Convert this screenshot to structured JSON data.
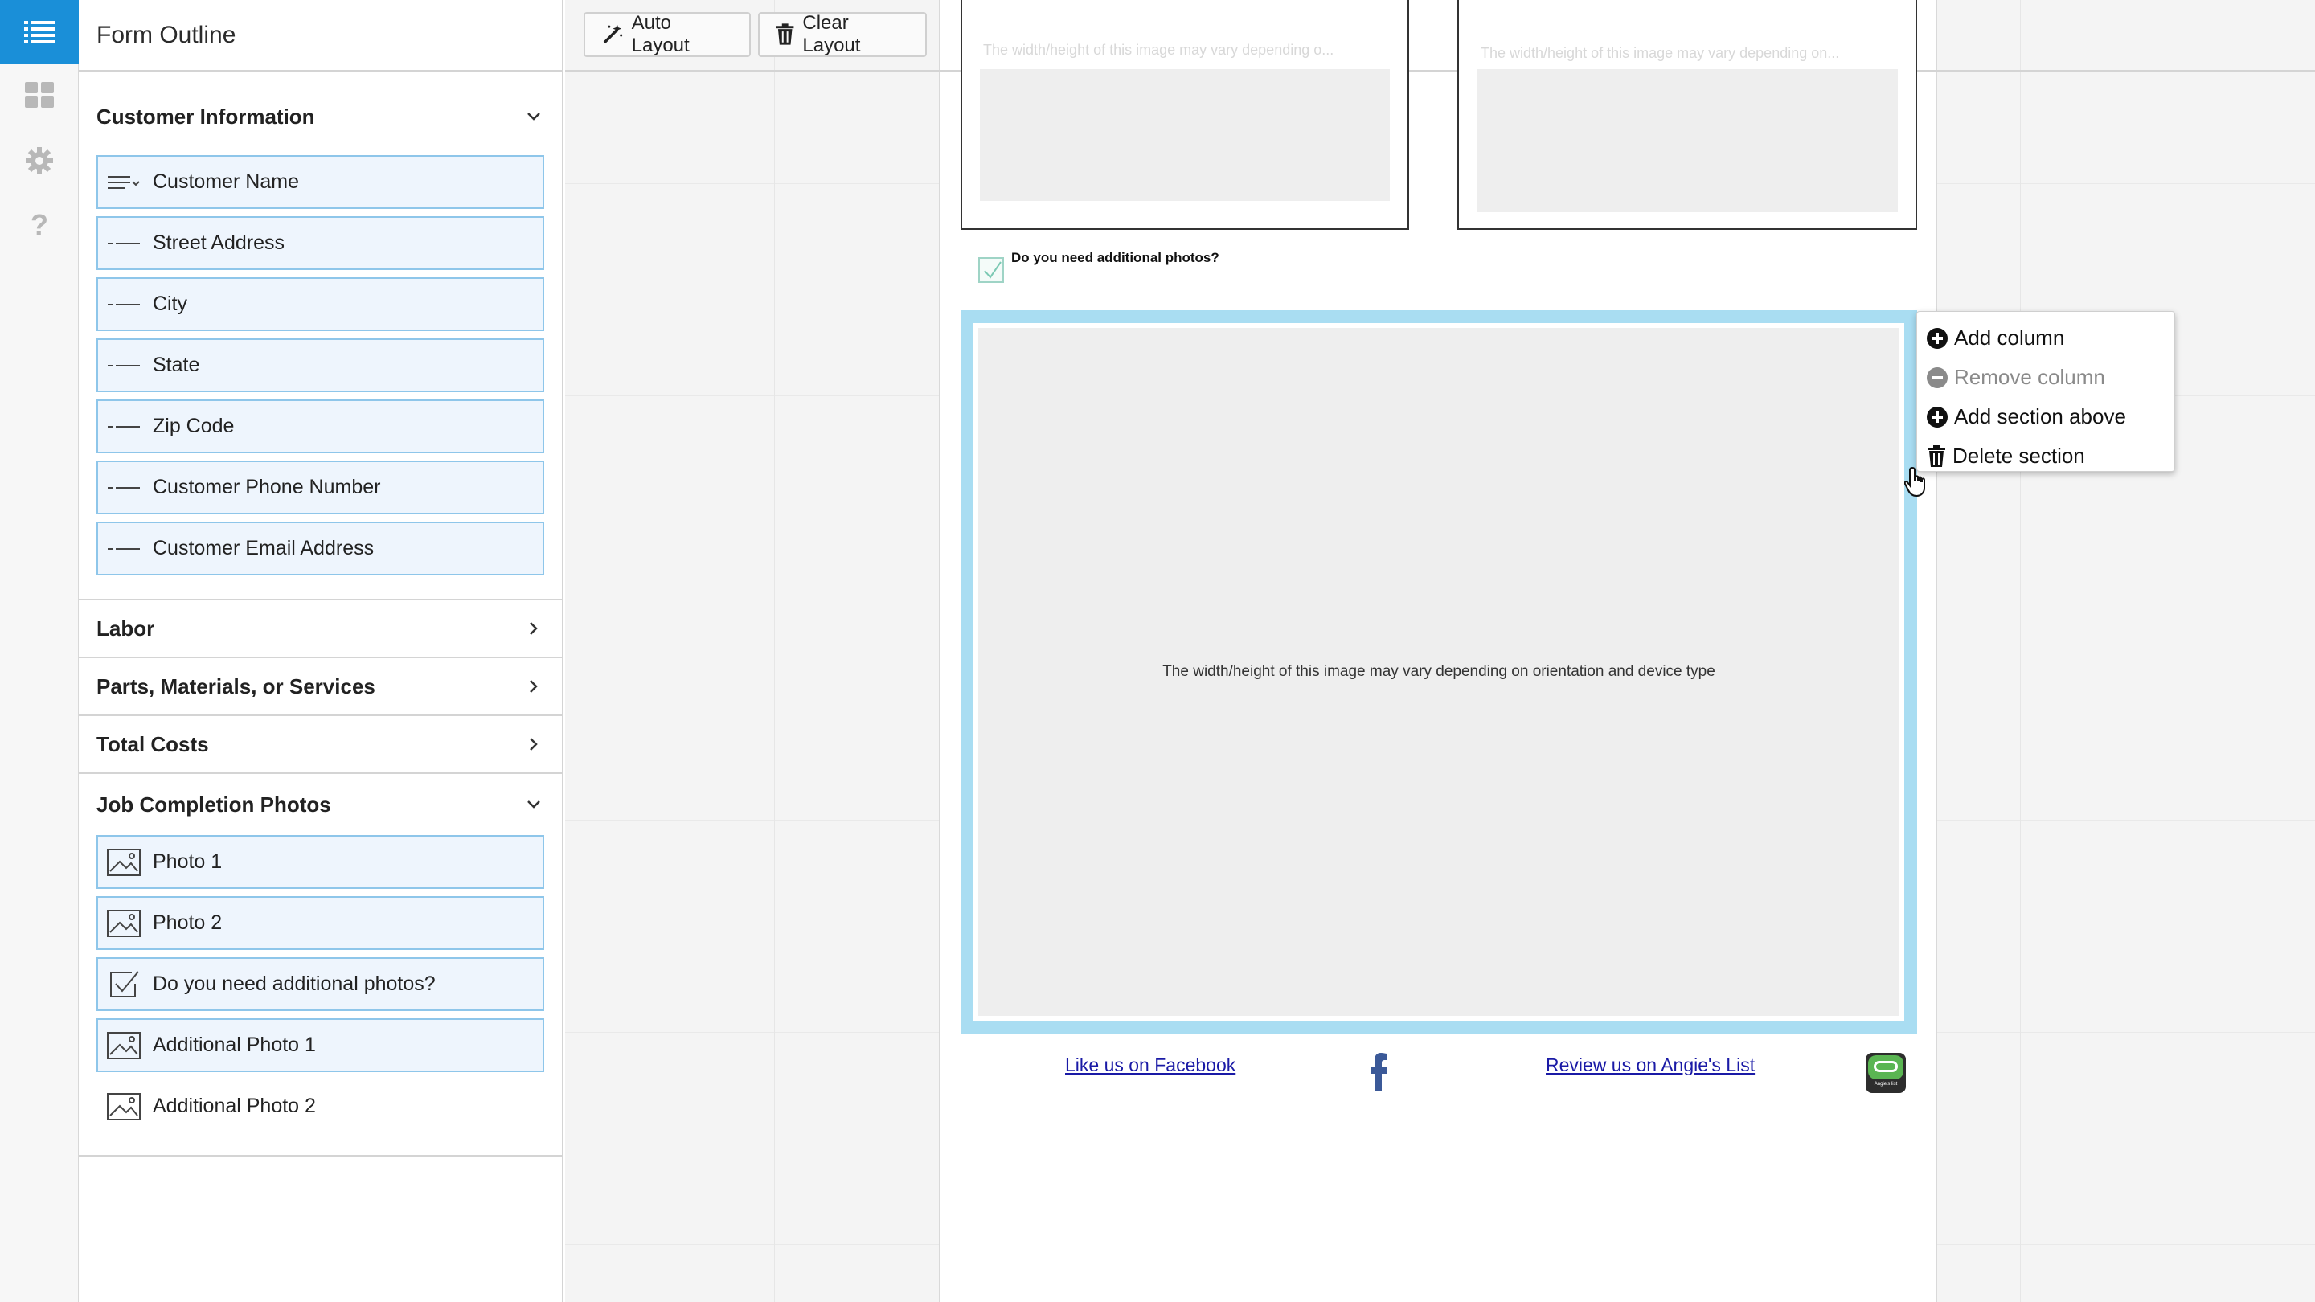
{
  "rail": {
    "items": [
      {
        "icon": "list-icon",
        "active": true
      },
      {
        "icon": "dashboard-icon"
      },
      {
        "icon": "gear-icon"
      },
      {
        "icon": "help-icon"
      }
    ]
  },
  "outline": {
    "title": "Form Outline",
    "sections": [
      {
        "label": "Customer Information",
        "expanded": true,
        "fields": [
          {
            "label": "Customer Name",
            "icon": "dropdown-text-icon"
          },
          {
            "label": "Street Address",
            "icon": "text-field-icon"
          },
          {
            "label": "City",
            "icon": "text-field-icon"
          },
          {
            "label": "State",
            "icon": "text-field-icon"
          },
          {
            "label": "Zip Code",
            "icon": "text-field-icon"
          },
          {
            "label": "Customer Phone Number",
            "icon": "text-field-icon"
          },
          {
            "label": "Customer Email Address",
            "icon": "text-field-icon"
          }
        ]
      },
      {
        "label": "Labor",
        "expanded": false
      },
      {
        "label": "Parts, Materials, or Services",
        "expanded": false
      },
      {
        "label": "Total Costs",
        "expanded": false
      },
      {
        "label": "Job Completion Photos",
        "expanded": true,
        "fields": [
          {
            "label": "Photo 1",
            "icon": "image-icon"
          },
          {
            "label": "Photo 2",
            "icon": "image-icon"
          },
          {
            "label": "Do you need additional photos?",
            "icon": "checkbox-icon"
          },
          {
            "label": "Additional Photo 1",
            "icon": "image-icon"
          },
          {
            "label": "Additional Photo 2",
            "icon": "image-icon",
            "unplaced": true
          }
        ]
      }
    ]
  },
  "toolbar": {
    "auto_layout": "Auto Layout",
    "clear_layout": "Clear Layout"
  },
  "form": {
    "photo_placeholder_faint_1": "The width/height of this image may vary depending o...",
    "photo_placeholder_faint_2": "The width/height of this image may vary depending on...",
    "checkbox_label": "Do you need additional photos?",
    "selected_placeholder": "The width/height of this image may vary depending on orientation and device type",
    "facebook_link": "Like us on Facebook",
    "angies_link": "Review us on Angie's List",
    "angies_logo_text": "Angie's list"
  },
  "context_menu": {
    "items": [
      {
        "label": "Add column",
        "icon": "plus-circle-icon",
        "enabled": true
      },
      {
        "label": "Remove column",
        "icon": "minus-circle-icon",
        "enabled": false
      },
      {
        "label": "Add section above",
        "icon": "plus-circle-icon",
        "enabled": true
      },
      {
        "label": "Delete section",
        "icon": "trash-icon",
        "enabled": true
      }
    ]
  },
  "colors": {
    "accent": "#1a8fd8",
    "field_border": "#8ec6ea",
    "field_bg": "#eef5fd",
    "selection": "#a9ddf2",
    "link": "#1a1aa6",
    "facebook": "#3b5998",
    "angies_green": "#5ab552"
  }
}
